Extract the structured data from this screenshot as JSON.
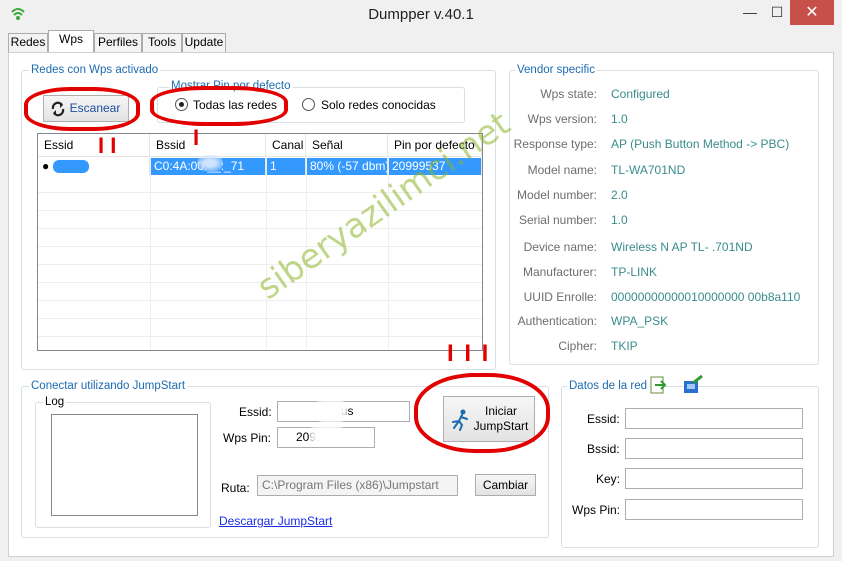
{
  "window": {
    "title": "Dumpper v.40.1",
    "minimize": "—",
    "maximize": "☐",
    "close": "✕"
  },
  "tabs": [
    "Redes",
    "Wps",
    "Perfiles",
    "Tools",
    "Update"
  ],
  "wps_group": {
    "title": "Redes con Wps activado",
    "scan_button": "Escanear",
    "pin_group_title": "Mostrar Pin por defecto",
    "radio_all": "Todas las redes",
    "radio_known": "Solo redes conocidas",
    "columns": [
      "Essid",
      "Bssid",
      "Canal",
      "Señal",
      "Pin por defecto"
    ],
    "rows": [
      {
        "essid": "",
        "bssid": "C0:4A:00:__:_71",
        "canal": "1",
        "senal": "80% (-57 dbm)",
        "pin": "20999537"
      }
    ]
  },
  "vendor": {
    "title": "Vendor specific",
    "fields": [
      {
        "label": "Wps state:",
        "value": "Configured"
      },
      {
        "label": "Wps version:",
        "value": "1.0"
      },
      {
        "label": "Response type:",
        "value": "AP (Push Button Method -> PBC)"
      },
      {
        "label": "Model name:",
        "value": "TL-WA701ND"
      },
      {
        "label": "Model number:",
        "value": "2.0"
      },
      {
        "label": "Serial number:",
        "value": "1.0"
      },
      {
        "label": "Device name:",
        "value": "Wireless N AP TL-    .701ND"
      },
      {
        "label": "Manufacturer:",
        "value": "TP-LINK"
      },
      {
        "label": "UUID Enrolle:",
        "value": "00000000000010000000       00b8a110"
      },
      {
        "label": "Authentication:",
        "value": "WPA_PSK"
      },
      {
        "label": "Cipher:",
        "value": "TKIP"
      }
    ]
  },
  "jumpstart": {
    "title": "Conectar utilizando JumpStart",
    "log_label": "Log",
    "essid_label": "Essid:",
    "essid_value": "Yus",
    "wpspin_label": "Wps Pin:",
    "wpspin_value": "20999",
    "start_button_line1": "Iniciar",
    "start_button_line2": "JumpStart",
    "ruta_label": "Ruta:",
    "ruta_value": "C:\\Program Files (x86)\\Jumpstart",
    "cambiar_button": "Cambiar",
    "download_link": "Descargar JumpStart"
  },
  "datos_red": {
    "title": "Datos de la red",
    "essid_label": "Essid:",
    "bssid_label": "Bssid:",
    "key_label": "Key:",
    "wpspin_label": "Wps Pin:"
  },
  "annotations": {
    "mark1": "I I",
    "mark2": "I",
    "mark3": "I I I"
  },
  "watermark": "siberyazilimci.net",
  "colors": {
    "accent": "#1c6bb1",
    "selection": "#3399ff",
    "vendor_value": "#3a8c8c",
    "mark": "#e20000"
  }
}
